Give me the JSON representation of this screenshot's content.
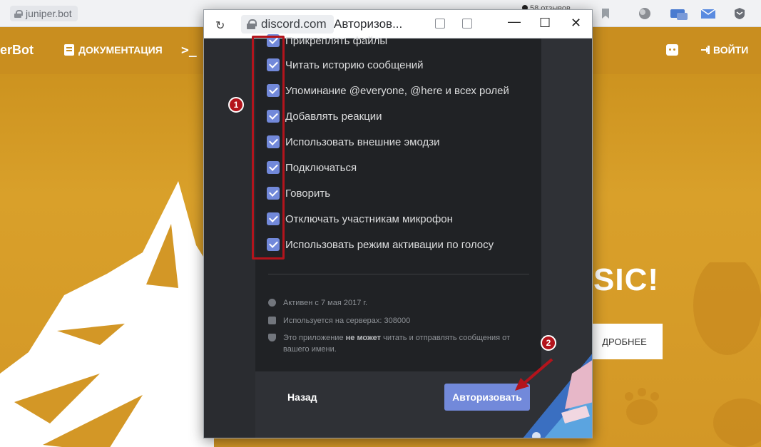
{
  "browser": {
    "address": "juniper.bot",
    "reviews_text": "58 отзывов"
  },
  "site": {
    "brand": "erBot",
    "nav_docs": "ДОКУМЕНТАЦИЯ",
    "nav_cmd": "_",
    "nav_login": "ВОЙТИ",
    "hero_title": "SIC!",
    "hero_button": "ДРОБНЕЕ"
  },
  "popup": {
    "url": "discord.com",
    "title": "Авторизов...",
    "permissions": [
      "Прикреплять файлы",
      "Читать историю сообщений",
      "Упоминание @everyone, @here и всех ролей",
      "Добавлять реакции",
      "Использовать внешние эмодзи",
      "Подключаться",
      "Говорить",
      "Отключать участникам микрофон",
      "Использовать режим активации по голосу"
    ],
    "meta_active": "Активен с 7 мая 2017 г.",
    "meta_servers": "Используется на серверах: 308000",
    "meta_privacy_pre": "Это приложение ",
    "meta_privacy_bold": "не может",
    "meta_privacy_post": " читать и отправлять сообщения от вашего имени.",
    "back_label": "Назад",
    "authorize_label": "Авторизовать"
  },
  "annotations": {
    "badge1": "1",
    "badge2": "2"
  },
  "colors": {
    "site_bg": "#d39726",
    "modal_bg": "#202225",
    "checkbox": "#7289da",
    "annotation": "#b3141c"
  }
}
